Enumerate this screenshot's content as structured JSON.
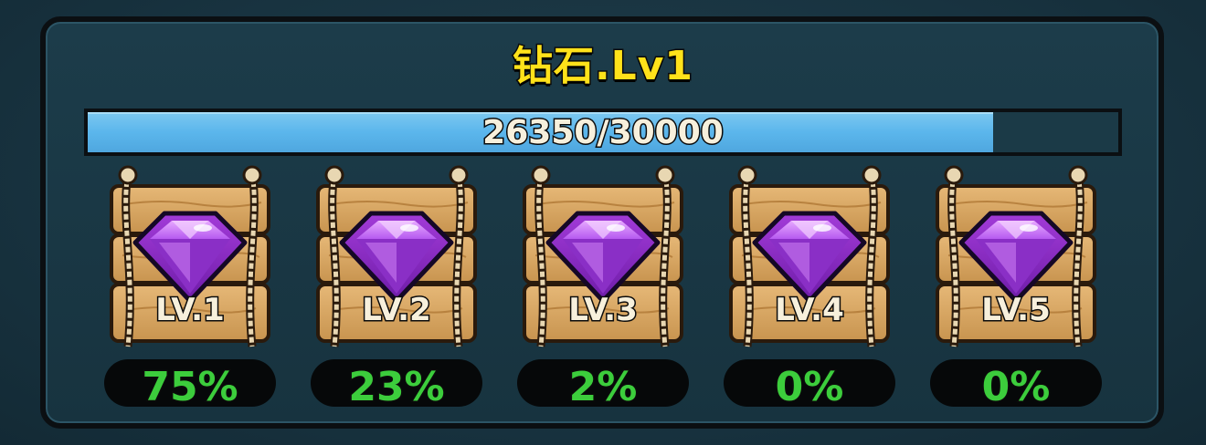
{
  "panel": {
    "title": "钻石.Lv1"
  },
  "progress": {
    "text": "26350/30000",
    "current": 26350,
    "max": 30000,
    "fill_color": "#5bb6ec"
  },
  "levels": [
    {
      "label": "LV.1",
      "chance": "75%",
      "icon": "purple-gem-icon"
    },
    {
      "label": "LV.2",
      "chance": "23%",
      "icon": "purple-gem-icon"
    },
    {
      "label": "LV.3",
      "chance": "2%",
      "icon": "purple-gem-icon"
    },
    {
      "label": "LV.4",
      "chance": "0%",
      "icon": "purple-gem-icon"
    },
    {
      "label": "LV.5",
      "chance": "0%",
      "icon": "purple-gem-icon"
    }
  ],
  "colors": {
    "title": "#ffe21a",
    "chance": "#3ccd3c",
    "gem": "#a23bd8",
    "wood": "#d9a864"
  }
}
